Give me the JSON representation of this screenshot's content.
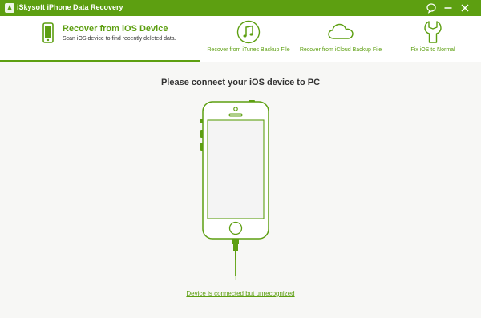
{
  "app": {
    "title": "iSkysoft iPhone Data Recovery",
    "accent_color": "#5d9f11",
    "window_controls": [
      "feedback-icon",
      "minimize-icon",
      "close-icon"
    ]
  },
  "modes": {
    "active": {
      "title": "Recover from iOS Device",
      "subtitle": "Scan iOS device to find recently deleted data.",
      "icon": "phone-icon"
    },
    "tabs": [
      {
        "label": "Recover from iTunes Backup File",
        "icon": "music-note-icon"
      },
      {
        "label": "Recover from iCloud Backup File",
        "icon": "cloud-icon"
      },
      {
        "label": "Fix iOS to Normal",
        "icon": "wrench-icon"
      }
    ]
  },
  "main": {
    "heading": "Please connect your iOS device to PC",
    "device_illustration": "iphone-with-cable",
    "status_link": "Device is connected but unrecognized"
  }
}
